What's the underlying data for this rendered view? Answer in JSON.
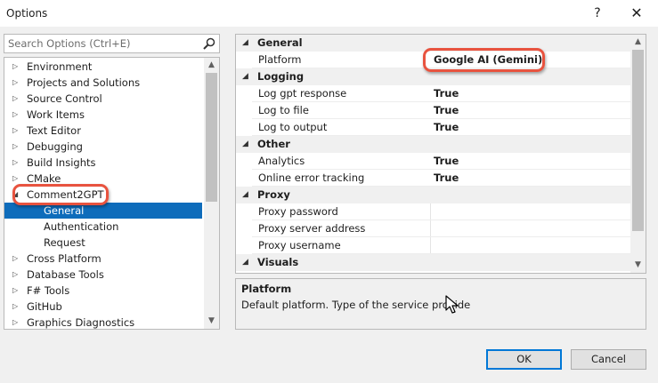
{
  "window": {
    "title": "Options",
    "help_label": "?",
    "close_label": "✕"
  },
  "search": {
    "placeholder": "Search Options (Ctrl+E)"
  },
  "tree": {
    "items": [
      {
        "label": "Environment",
        "expanded": false
      },
      {
        "label": "Projects and Solutions",
        "expanded": false
      },
      {
        "label": "Source Control",
        "expanded": false
      },
      {
        "label": "Work Items",
        "expanded": false
      },
      {
        "label": "Text Editor",
        "expanded": false
      },
      {
        "label": "Debugging",
        "expanded": false
      },
      {
        "label": "Build Insights",
        "expanded": false
      },
      {
        "label": "CMake",
        "expanded": false
      },
      {
        "label": "Comment2GPT",
        "expanded": true
      },
      {
        "label": "General",
        "selected": true
      },
      {
        "label": "Authentication"
      },
      {
        "label": "Request"
      },
      {
        "label": "Cross Platform",
        "expanded": false
      },
      {
        "label": "Database Tools",
        "expanded": false
      },
      {
        "label": "F# Tools",
        "expanded": false
      },
      {
        "label": "GitHub",
        "expanded": false
      },
      {
        "label": "Graphics Diagnostics",
        "expanded": false
      }
    ]
  },
  "properties": {
    "categories": [
      {
        "name": "General",
        "rows": [
          {
            "name": "Platform",
            "value": "Google AI (Gemini)"
          }
        ]
      },
      {
        "name": "Logging",
        "rows": [
          {
            "name": "Log gpt response",
            "value": "True"
          },
          {
            "name": "Log to file",
            "value": "True"
          },
          {
            "name": "Log to output",
            "value": "True"
          }
        ]
      },
      {
        "name": "Other",
        "rows": [
          {
            "name": "Analytics",
            "value": "True"
          },
          {
            "name": "Online error tracking",
            "value": "True"
          }
        ]
      },
      {
        "name": "Proxy",
        "rows": [
          {
            "name": "Proxy password",
            "value": ""
          },
          {
            "name": "Proxy server address",
            "value": ""
          },
          {
            "name": "Proxy username",
            "value": ""
          }
        ]
      },
      {
        "name": "Visuals",
        "rows": []
      }
    ]
  },
  "description": {
    "title": "Platform",
    "text": "Default platform. Type of the service provide"
  },
  "buttons": {
    "ok": "OK",
    "cancel": "Cancel"
  },
  "colors": {
    "selection": "#0e6cbb",
    "highlight_ring": "#e8533f",
    "ok_border": "#0078d7"
  }
}
